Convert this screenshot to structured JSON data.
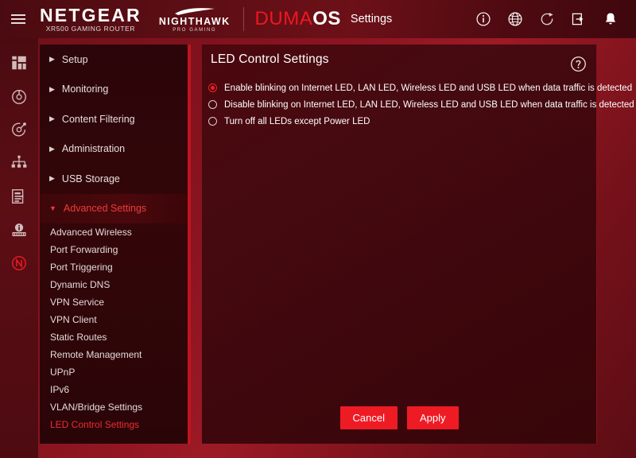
{
  "header": {
    "menu_icon": "hamburger-icon",
    "netgear_name": "NETGEAR",
    "netgear_sub": "XR500 GAMING ROUTER",
    "nighthawk_name": "NIGHTHAWK",
    "nighthawk_sub": "PRO GAMING",
    "duma_red": "DUMA",
    "duma_os": "OS",
    "settings_label": "Settings",
    "icons": [
      {
        "name": "info-icon"
      },
      {
        "name": "globe-icon"
      },
      {
        "name": "refresh-icon"
      },
      {
        "name": "logout-icon"
      },
      {
        "name": "bell-icon"
      }
    ]
  },
  "rail": {
    "items": [
      {
        "name": "dashboard-icon"
      },
      {
        "name": "speedometer-icon"
      },
      {
        "name": "ping-target-icon"
      },
      {
        "name": "network-map-icon"
      },
      {
        "name": "traffic-report-icon"
      },
      {
        "name": "device-info-icon"
      },
      {
        "name": "netduma-logo-icon"
      }
    ]
  },
  "sidebar": {
    "top_items": [
      {
        "label": "Setup",
        "expanded": false
      },
      {
        "label": "Monitoring",
        "expanded": false
      },
      {
        "label": "Content Filtering",
        "expanded": false
      },
      {
        "label": "Administration",
        "expanded": false
      },
      {
        "label": "USB Storage",
        "expanded": false
      },
      {
        "label": "Advanced Settings",
        "expanded": true
      }
    ],
    "sub_items": [
      {
        "label": "Advanced Wireless",
        "selected": false
      },
      {
        "label": "Port Forwarding",
        "selected": false
      },
      {
        "label": "Port Triggering",
        "selected": false
      },
      {
        "label": "Dynamic DNS",
        "selected": false
      },
      {
        "label": "VPN Service",
        "selected": false
      },
      {
        "label": "VPN Client",
        "selected": false
      },
      {
        "label": "Static Routes",
        "selected": false
      },
      {
        "label": "Remote Management",
        "selected": false
      },
      {
        "label": "UPnP",
        "selected": false
      },
      {
        "label": "IPv6",
        "selected": false
      },
      {
        "label": "VLAN/Bridge Settings",
        "selected": false
      },
      {
        "label": "LED Control Settings",
        "selected": true
      }
    ],
    "caret_collapsed": "▶",
    "caret_expanded": "▼"
  },
  "main": {
    "title": "LED Control Settings",
    "help_icon": "help-circle-icon",
    "options": [
      {
        "label": "Enable blinking on Internet LED, LAN LED, Wireless LED and USB LED when data traffic is detected",
        "checked": true
      },
      {
        "label": "Disable blinking on Internet LED, LAN LED, Wireless LED and USB LED when data traffic is detected",
        "checked": false
      },
      {
        "label": "Turn off all LEDs except Power LED",
        "checked": false
      }
    ],
    "cancel_label": "Cancel",
    "apply_label": "Apply"
  },
  "colors": {
    "accent_red": "#ee1b24",
    "duma_red": "#f0171f",
    "selected_text": "#ee2b33",
    "panel_dark": "#3e070d"
  }
}
